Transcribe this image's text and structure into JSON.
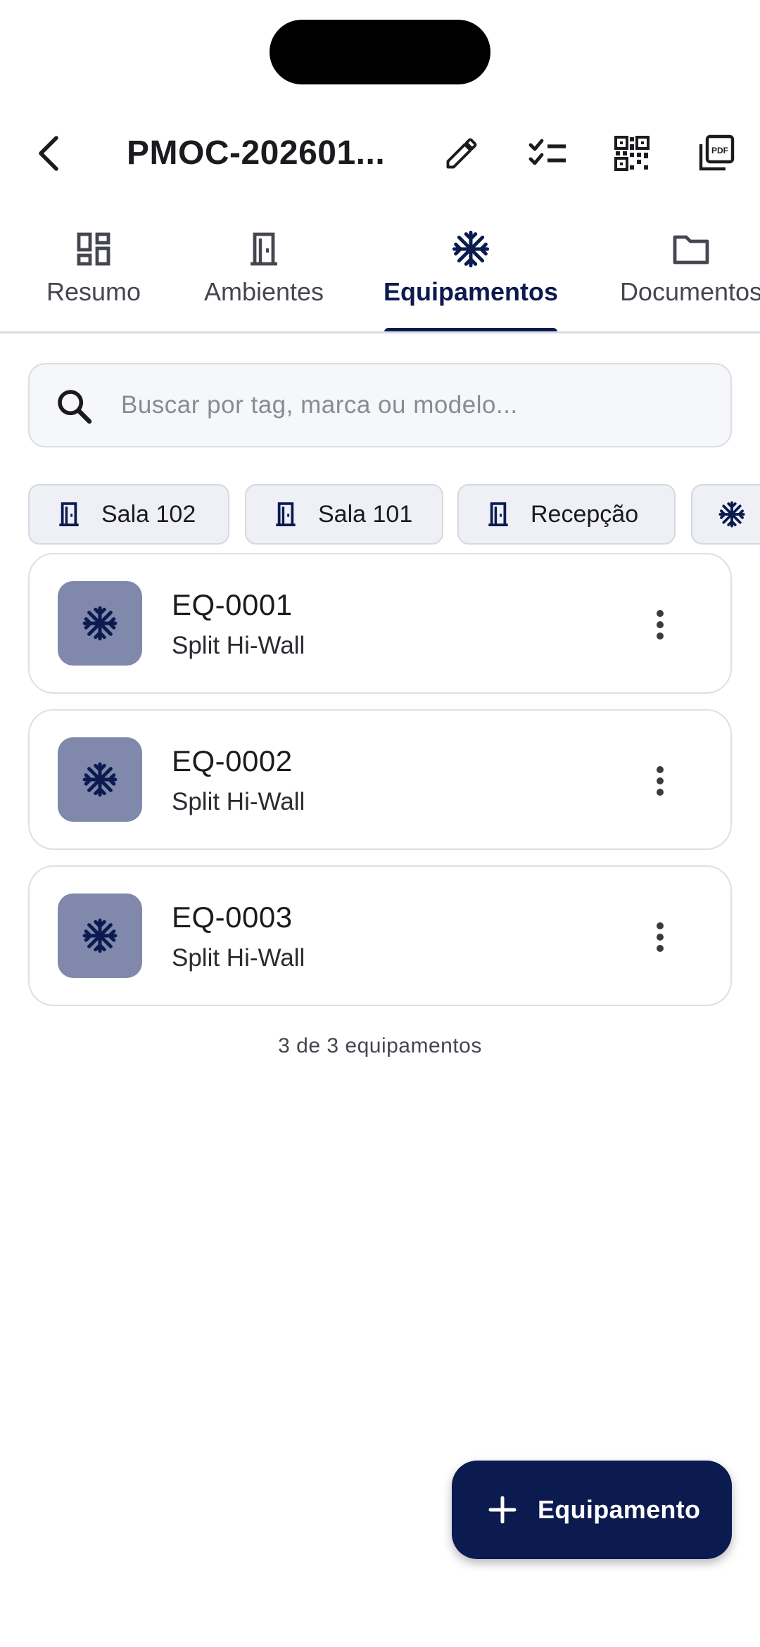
{
  "appbar": {
    "title": "PMOC-202601...",
    "actions": [
      "edit-icon",
      "checklist-icon",
      "qr-code-icon",
      "pdf-icon"
    ]
  },
  "tabs": [
    {
      "label": "Resumo",
      "icon": "dashboard-icon",
      "active": false
    },
    {
      "label": "Ambientes",
      "icon": "door-icon",
      "active": false
    },
    {
      "label": "Equipamentos",
      "icon": "snowflake-icon",
      "active": true
    },
    {
      "label": "Documentos",
      "icon": "folder-icon",
      "active": false
    }
  ],
  "search": {
    "placeholder": "Buscar por tag, marca ou modelo...",
    "value": ""
  },
  "filters": [
    {
      "label": "Sala 102",
      "icon": "door-icon"
    },
    {
      "label": "Sala 101",
      "icon": "door-icon"
    },
    {
      "label": "Recepção",
      "icon": "door-icon"
    },
    {
      "label": "",
      "icon": "snowflake-icon"
    }
  ],
  "equipments": [
    {
      "tag": "EQ-0001",
      "type": "Split Hi-Wall"
    },
    {
      "tag": "EQ-0002",
      "type": "Split Hi-Wall"
    },
    {
      "tag": "EQ-0003",
      "type": "Split Hi-Wall"
    }
  ],
  "count_text": "3 de 3 equipamentos",
  "fab": {
    "label": "Equipamento",
    "icon": "plus-icon"
  },
  "colors": {
    "primary": "#0b1a4f",
    "icon_tile": "#8089ab",
    "chip_bg": "#eef0f6",
    "search_bg": "#f6f7fb"
  }
}
